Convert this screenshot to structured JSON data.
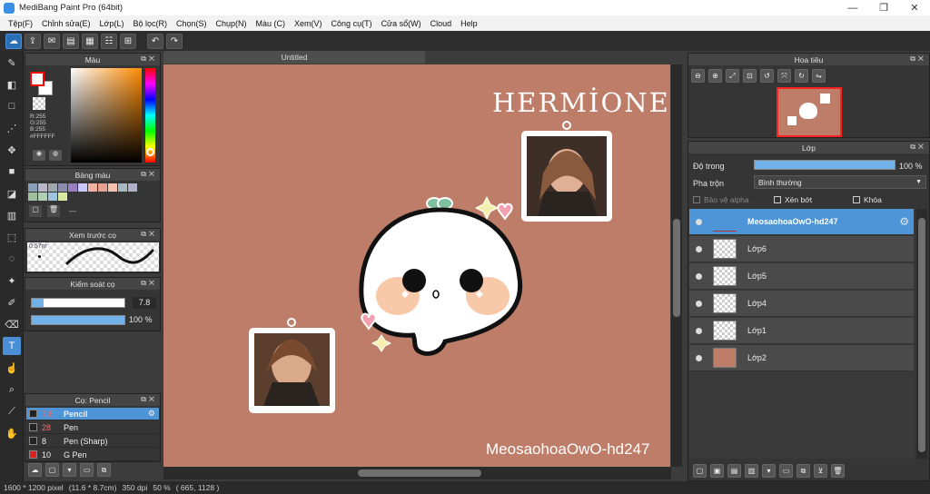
{
  "window": {
    "title": "MediBang Paint Pro (64bit)",
    "min": "—",
    "restore": "❐",
    "close": "✕"
  },
  "menu": [
    "Tệp(F)",
    "Chỉnh sửa(E)",
    "Lớp(L)",
    "Bộ lọc(R)",
    "Chọn(S)",
    "Chụp(N)",
    "Màu (C)",
    "Xem(V)",
    "Công cụ(T)",
    "Cửa sổ(W)",
    "Cloud",
    "Help"
  ],
  "color_panel": {
    "title": "Màu",
    "r": "R:255",
    "g": "G:255",
    "b": "B:255",
    "hex": "#FFFFFF"
  },
  "palette_panel": {
    "title": "Bảng màu",
    "name": "---"
  },
  "brush_preview_panel": {
    "title": "Xem trước cọ",
    "size": "0.57m"
  },
  "brush_control_panel": {
    "title": "Kiểm soát cọ",
    "size_value": "7.8",
    "opacity_value": "100 %"
  },
  "brush_panel": {
    "title": "Cọ: Pencil",
    "items": [
      {
        "size": "7.8",
        "name": "Pencil",
        "selected": true
      },
      {
        "size": "28",
        "name": "Pen",
        "selected": false
      },
      {
        "size": "8",
        "name": "Pen (Sharp)",
        "selected": false
      },
      {
        "size": "10",
        "name": "G Pen",
        "selected": false
      }
    ]
  },
  "canvas": {
    "tab_title": "Untitled",
    "heading_text": "HERMİONE",
    "watermark": "MeosaohoaOwO-hd247"
  },
  "navigator_panel": {
    "title": "Hoa tiêu"
  },
  "layer_panel": {
    "title": "Lớp",
    "opacity_label": "Độ trong",
    "opacity_value": "100 %",
    "opacity_fraction": 1.0,
    "blend_label": "Pha trộn",
    "blend_value": "Bình thường",
    "protect_alpha": "Bảo vệ alpha",
    "clipping": "Xén bớt",
    "lock": "Khóa",
    "layers": [
      {
        "name": "MeosaohoaOwO-hd247",
        "selected": true
      },
      {
        "name": "Lớp6",
        "selected": false
      },
      {
        "name": "Lớp5",
        "selected": false
      },
      {
        "name": "Lớp4",
        "selected": false
      },
      {
        "name": "Lớp1",
        "selected": false
      },
      {
        "name": "Lớp2",
        "selected": false
      }
    ]
  },
  "status": {
    "size": "1600 * 1200 pixel",
    "cm": "(11.6 * 8.7cm)",
    "dpi": "350 dpi",
    "zoom": "50 %",
    "coords": "( 665, 1128 )"
  },
  "colors": {
    "canvas_bg": "#be7d68",
    "accent": "#4d95d6",
    "fg_color": "#ff0000",
    "bg_color": "#ffffff"
  }
}
